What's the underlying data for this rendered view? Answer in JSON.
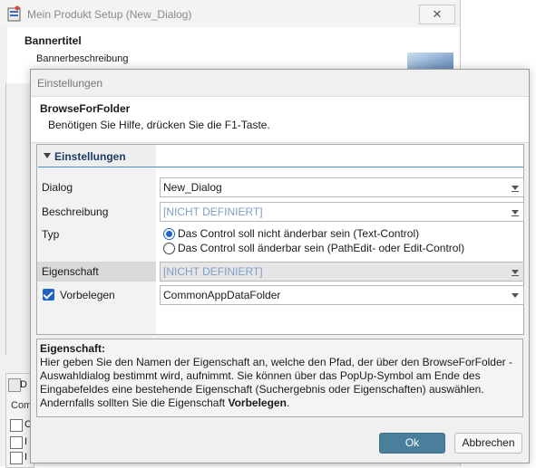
{
  "background_window": {
    "title": "Mein Produkt Setup  (New_Dialog)",
    "close_symbol": "✕",
    "banner_title": "Bannertitel",
    "banner_description": "Bannerbeschreibung",
    "tab_label": "D",
    "list_header": "Comm",
    "checkbox_labels": [
      "C",
      "I",
      "I"
    ]
  },
  "dialog": {
    "title": "Einstellungen",
    "header": {
      "title": "BrowseForFolder",
      "subtitle": "Benötigen Sie Hilfe, drücken Sie die F1-Taste."
    },
    "grid": {
      "category": "Einstellungen",
      "dialog_label": "Dialog",
      "dialog_value": "New_Dialog",
      "description_label": "Beschreibung",
      "description_value": "[NICHT DEFINIERT]",
      "type_label": "Typ",
      "type_options": [
        "Das Control soll nicht änderbar sein (Text-Control)",
        "Das Control soll änderbar sein (PathEdit- oder Edit-Control)"
      ],
      "type_selected_index": 0,
      "property_label": "Eigenschaft",
      "property_value": "[NICHT DEFINIERT]",
      "preset_label": "Vorbelegen",
      "preset_checked": true,
      "preset_value": "CommonAppDataFolder"
    },
    "help": {
      "title": "Eigenschaft:",
      "text_part1": "Hier geben Sie den Namen der Eigenschaft an, welche den Pfad, der über den BrowseForFolder -Auswahldialog bestimmt wird, aufnimmt. Sie können über das PopUp-Symbol am Ende des Eingabefeldes eine bestehende Eigenschaft (Suchergebnis oder Eigenschaften) auswählen. Andernfalls sollten Sie die Eigenschaft ",
      "text_bold": "Vorbelegen",
      "text_part2": "."
    },
    "buttons": {
      "ok": "Ok",
      "cancel": "Abbrechen"
    }
  },
  "colors": {
    "accent": "#1f63c4",
    "ok_button": "#4a7f9b",
    "undefined_text": "#7e9ec9"
  }
}
